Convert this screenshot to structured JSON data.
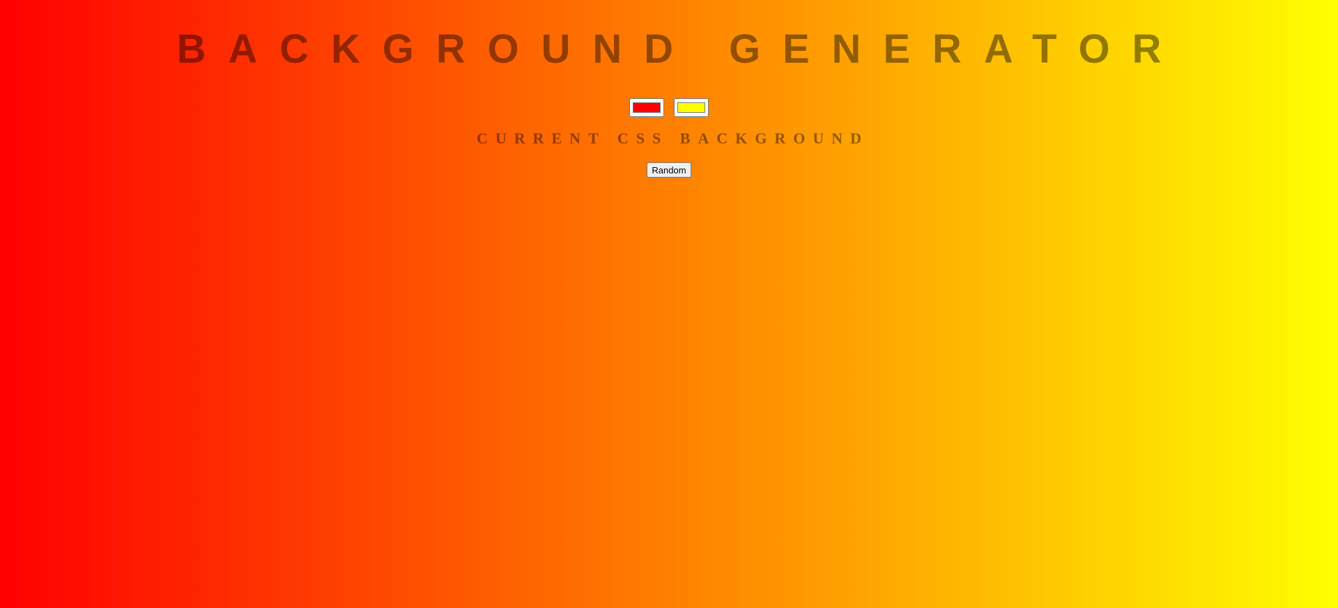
{
  "header": {
    "title": "BACKGROUND GENERATOR"
  },
  "pickers": {
    "color1": "#ff0000",
    "color2": "#ffff00"
  },
  "current_css_label": "CURRENT CSS BACKGROUND",
  "random_button_label": "Random",
  "colors": {
    "gradient_start": "#ff0000",
    "gradient_end": "#ffff00",
    "text": "rgba(0,0,0,0.45)"
  }
}
